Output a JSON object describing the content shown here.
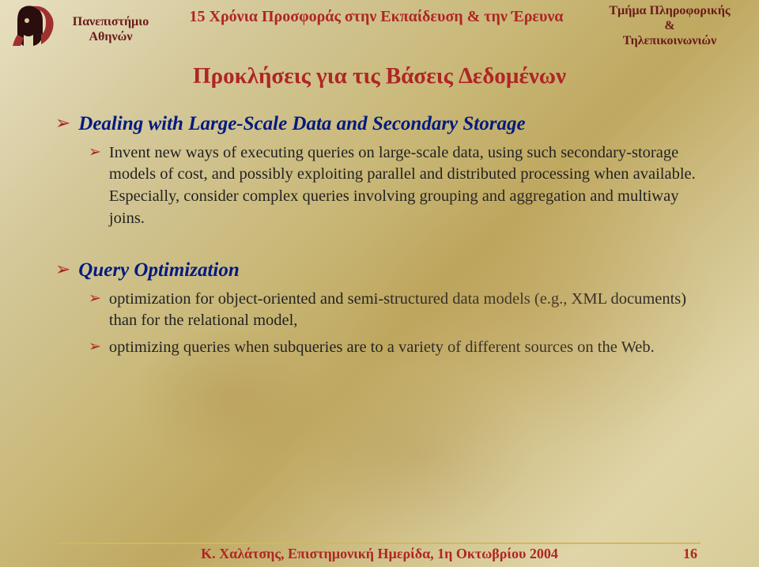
{
  "header": {
    "uni_line1": "Πανεπιστήµιο",
    "uni_line2": "Αθηνών",
    "center": "15 Χρόνια Προσφοράς στην Εκπαίδευση & την Έρευνα",
    "dept_line1": "Τµήµα Πληροφορικής",
    "dept_line2": "&",
    "dept_line3": "Τηλεπικοινωνιών"
  },
  "title": "Προκλήσεις για τις Βάσεις ∆εδοµένων",
  "sections": [
    {
      "heading": "Dealing with Large-Scale Data and Secondary Storage",
      "items": [
        "Invent new ways of executing queries on large-scale data, using such secondary-storage models of cost, and possibly exploiting parallel and distributed processing when available. Especially, consider complex queries involving grouping and aggregation and multiway joins."
      ]
    },
    {
      "heading": "Query Optimization",
      "items": [
        "optimization for object-oriented and semi-structured data models (e.g., XML documents) than for the relational model,",
        " optimizing queries when subqueries are to a variety of different sources on the Web."
      ]
    }
  ],
  "footer": {
    "text": "Κ. Χαλάτσης, Επιστηµονική Ηµερίδα, 1η Οκτωβρίου 2004",
    "page": "16"
  }
}
